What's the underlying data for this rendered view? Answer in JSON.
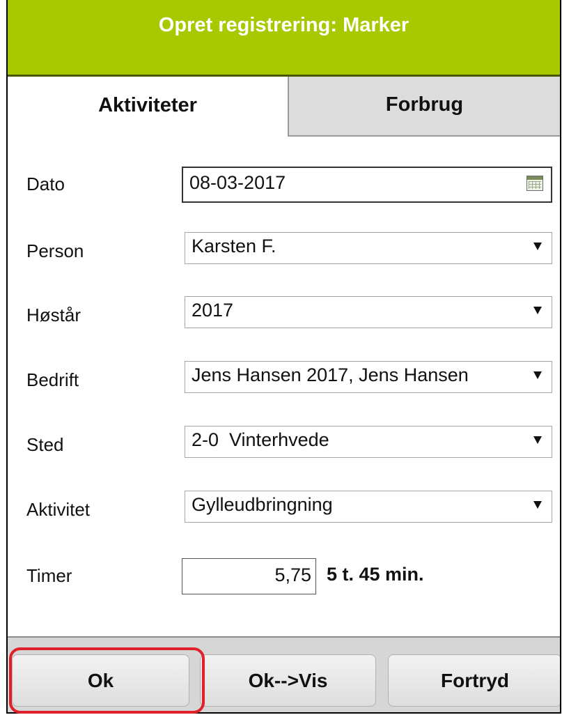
{
  "header": {
    "title": "Opret registrering: Marker"
  },
  "tabs": [
    {
      "label": "Aktiviteter",
      "active": true
    },
    {
      "label": "Forbrug",
      "active": false
    }
  ],
  "form": {
    "date": {
      "label": "Dato",
      "value": "08-03-2017"
    },
    "person": {
      "label": "Person",
      "value": "Karsten F."
    },
    "harvest_year": {
      "label": "Høstår",
      "value": "2017"
    },
    "company": {
      "label": "Bedrift",
      "value": "Jens Hansen 2017, Jens Hansen"
    },
    "location": {
      "label": "Sted",
      "value": "2-0  Vinterhvede"
    },
    "activity": {
      "label": "Aktivitet",
      "value": "Gylleudbringning"
    },
    "hours": {
      "label": "Timer",
      "value": "5,75",
      "display": "5 t. 45 min."
    }
  },
  "buttons": {
    "ok": "Ok",
    "ok_view": "Ok-->Vis",
    "cancel": "Fortryd"
  },
  "icons": {
    "calendar": "calendar-icon",
    "dropdown": "chevron-down-icon"
  },
  "colors": {
    "header": "#a8c800",
    "highlight": "#e0202a",
    "footer": "#d6d6d6"
  }
}
